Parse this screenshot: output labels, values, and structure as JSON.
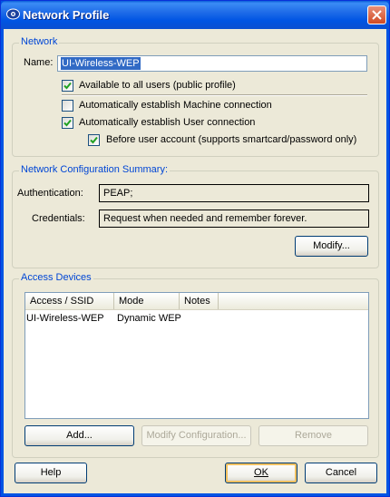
{
  "window": {
    "title": "Network Profile"
  },
  "network": {
    "group_title": "Network",
    "name_label": "Name:",
    "name_value": "UI-Wireless-WEP",
    "available_all_users": {
      "label": "Available to all users (public profile)",
      "checked": true
    },
    "auto_machine": {
      "label": "Automatically establish Machine connection",
      "checked": false
    },
    "auto_user": {
      "label": "Automatically establish User connection",
      "checked": true
    },
    "before_user_account": {
      "label": "Before user account (supports smartcard/password only)",
      "checked": true
    }
  },
  "summary": {
    "group_title": "Network Configuration Summary:",
    "auth_label": "Authentication:",
    "auth_value": "PEAP;",
    "cred_label": "Credentials:",
    "cred_value": "Request when needed and remember forever.",
    "modify_label": "Modify..."
  },
  "access_devices": {
    "group_title": "Access Devices",
    "columns": [
      "Access / SSID",
      "Mode",
      "Notes"
    ],
    "rows": [
      {
        "ssid": "UI-Wireless-WEP",
        "mode": "Dynamic WEP",
        "notes": ""
      }
    ],
    "add_label": "Add...",
    "modify_config_label": "Modify Configuration...",
    "remove_label": "Remove"
  },
  "footer": {
    "help_label": "Help",
    "ok_label": "OK",
    "cancel_label": "Cancel"
  },
  "colors": {
    "title_bar": "#0054e3",
    "group_title": "#0046d5",
    "dialog_bg": "#ece9d8",
    "close_button": "#d14a22"
  }
}
